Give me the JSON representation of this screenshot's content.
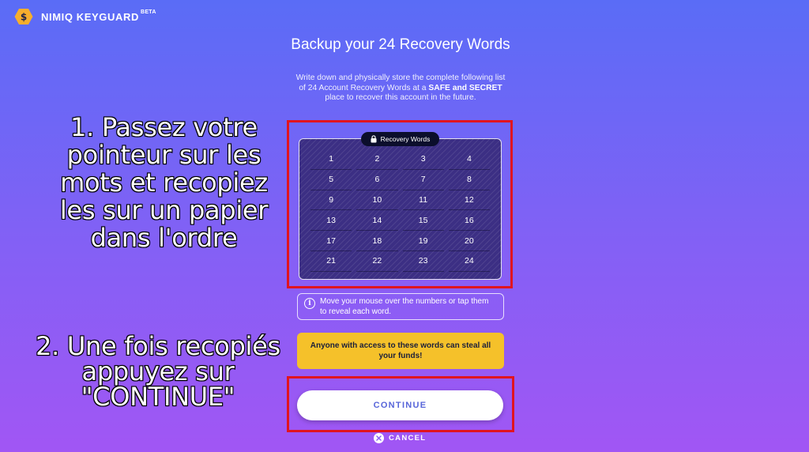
{
  "header": {
    "brand": "NIMIQ KEYGUARD",
    "badge": "BETA",
    "logo_icon": "nimiq-hexagon-logo-icon",
    "logo_color": "#f6ae2d"
  },
  "main": {
    "title": "Backup your 24 Recovery Words",
    "description_part1": "Write down and physically store the complete following list of 24 Account Recovery Words at a",
    "description_bold": "SAFE and SECRET",
    "description_part2": "place to recover this account in the future."
  },
  "recovery_words": {
    "label": "Recovery Words",
    "label_icon": "lock-icon",
    "numbers": [
      "1",
      "2",
      "3",
      "4",
      "5",
      "6",
      "7",
      "8",
      "9",
      "10",
      "11",
      "12",
      "13",
      "14",
      "15",
      "16",
      "17",
      "18",
      "19",
      "20",
      "21",
      "22",
      "23",
      "24"
    ]
  },
  "info": {
    "icon": "info-icon",
    "text": "Move your mouse over the numbers or tap them to reveal each word."
  },
  "warning": {
    "text": "Anyone with access to these words can steal all your funds!",
    "color": "#f5c12a"
  },
  "actions": {
    "continue_label": "CONTINUE",
    "cancel_label": "CANCEL",
    "cancel_icon": "close-circle-icon"
  },
  "annotations": {
    "step1": "1. Passez votre pointeur sur les mots et recopiez les sur un papier dans l'ordre",
    "step2": "2. Une fois recopiés appuyez sur \"CONTINUE\"",
    "highlight_color": "#e1141f"
  }
}
